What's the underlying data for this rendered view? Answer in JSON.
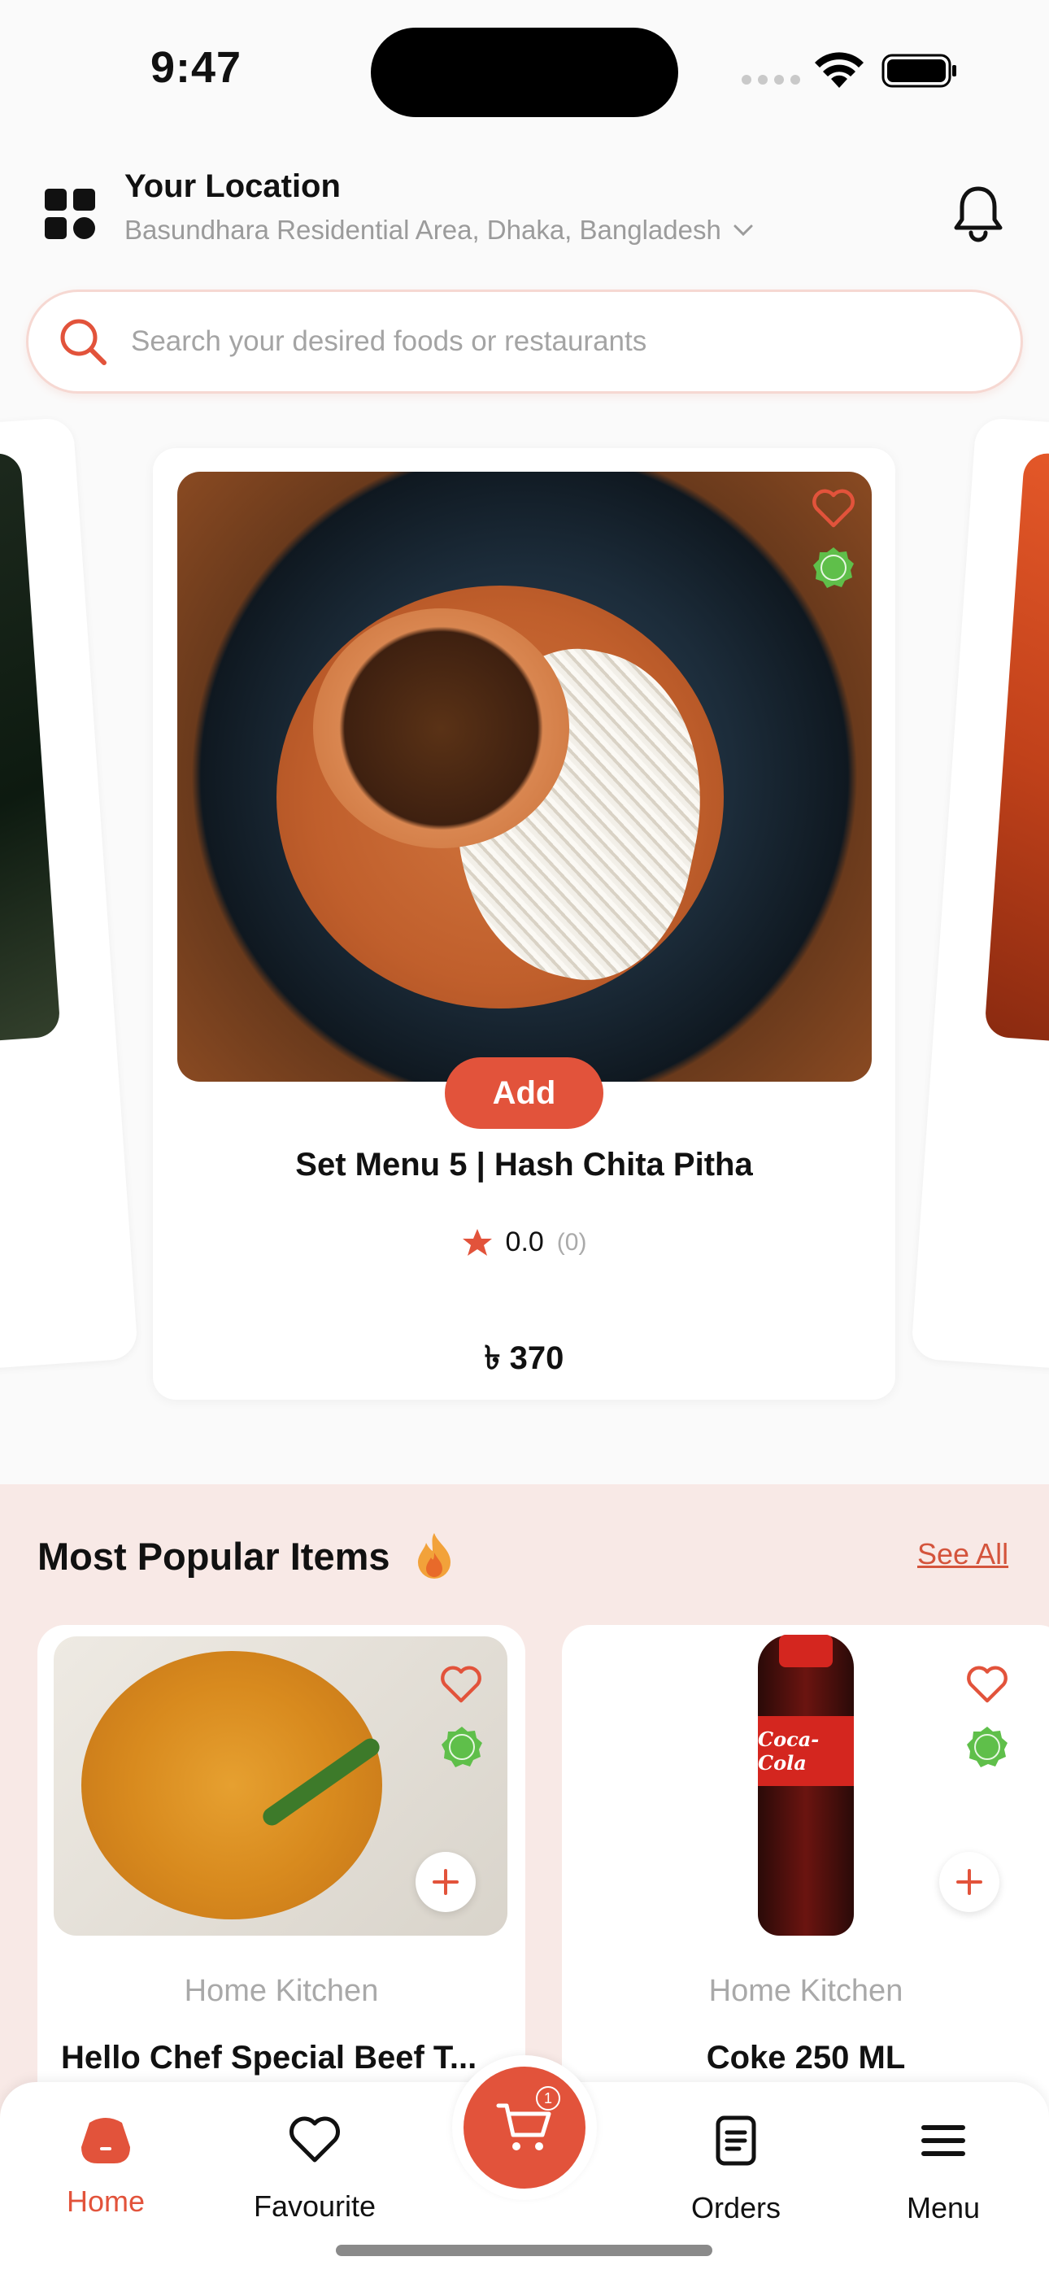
{
  "status_bar": {
    "time": "9:47"
  },
  "header": {
    "location_title": "Your Location",
    "location_address": "Basundhara Residential Area, Dhaka, Bangladesh"
  },
  "search": {
    "placeholder": "Search your desired foods or restaurants"
  },
  "featured": {
    "add_label": "Add",
    "name": "Set Menu 5 |  Hash Chita Pitha",
    "rating": "0.0",
    "rating_count": "(0)",
    "price": "৳ 370"
  },
  "popular": {
    "title": "Most Popular Items",
    "see_all": "See All",
    "items": [
      {
        "restaurant": "Home Kitchen",
        "name": "Hello Chef Special Beef T..."
      },
      {
        "restaurant": "Home Kitchen",
        "name": "Coke 250 ML",
        "brand_text": "Coca-Cola"
      }
    ]
  },
  "bottom_nav": {
    "home": "Home",
    "favourite": "Favourite",
    "cart_badge": "1",
    "orders": "Orders",
    "menu": "Menu"
  },
  "colors": {
    "accent": "#e2533b",
    "section_bg": "#f8e9e6"
  }
}
